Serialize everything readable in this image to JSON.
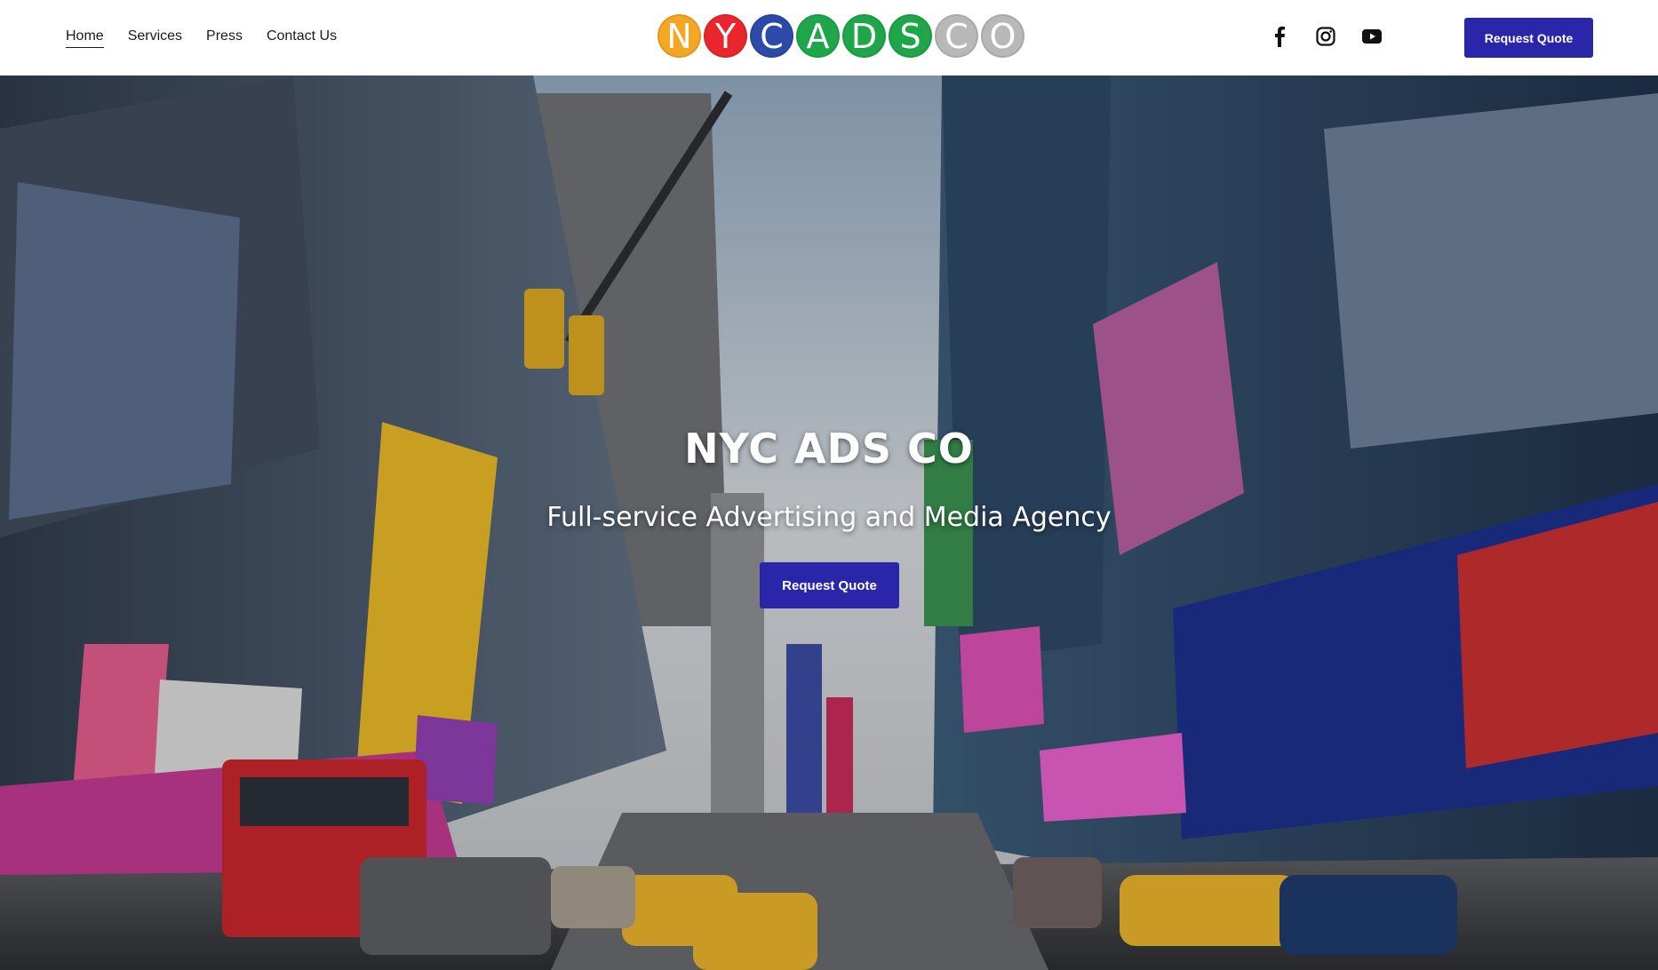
{
  "nav": {
    "items": [
      {
        "label": "Home",
        "active": true
      },
      {
        "label": "Services",
        "active": false
      },
      {
        "label": "Press",
        "active": false
      },
      {
        "label": "Contact Us",
        "active": false
      }
    ]
  },
  "logo": {
    "letters": [
      {
        "char": "N",
        "color": "#f5a623"
      },
      {
        "char": "Y",
        "color": "#e8262c"
      },
      {
        "char": "C",
        "color": "#2d4aa8"
      },
      {
        "char": "A",
        "color": "#1fa64a"
      },
      {
        "char": "D",
        "color": "#1fa64a"
      },
      {
        "char": "S",
        "color": "#1fa64a"
      },
      {
        "char": "C",
        "color": "#b8b8b8"
      },
      {
        "char": "O",
        "color": "#b8b8b8"
      }
    ]
  },
  "social": {
    "icons": [
      "facebook-icon",
      "instagram-icon",
      "youtube-icon"
    ]
  },
  "header": {
    "cta_label": "Request Quote"
  },
  "hero": {
    "title": "NYC ADS CO",
    "subtitle": "Full-service Advertising and Media Agency",
    "cta_label": "Request Quote",
    "background": "times-square-photo"
  },
  "colors": {
    "accent": "#2a26a9",
    "text": "#1a1a1a"
  }
}
